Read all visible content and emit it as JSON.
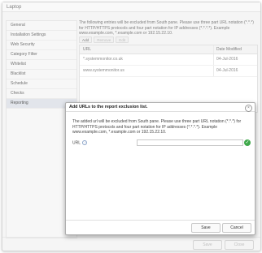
{
  "window": {
    "title": "Laptop"
  },
  "sidebar": {
    "items": [
      {
        "label": "General"
      },
      {
        "label": "Installation Settings"
      },
      {
        "label": "Web Security"
      },
      {
        "label": "Category Filter"
      },
      {
        "label": "Whitelist"
      },
      {
        "label": "Blacklist"
      },
      {
        "label": "Schedule"
      },
      {
        "label": "Checks"
      },
      {
        "label": "Reporting"
      }
    ],
    "active_index": 8
  },
  "main": {
    "description": "The following entries will be excluded from South pane. Please use three part URL notation (*.*.*) for HTTP/HTTPS protocols and four part notation for IP addresses (*.*.*.*). Example www.example.com, *.example.com or 192.15.22.10.",
    "toolbar": {
      "add_label": "Add",
      "remove_label": "Remove",
      "edit_label": "Edit"
    },
    "table": {
      "columns": [
        "URL",
        "Date Modified"
      ],
      "rows": [
        {
          "url": "*.systemmonitor.co.uk",
          "date": "04-Jul-2016"
        },
        {
          "url": "www.systemmonitor.us",
          "date": "04-Jul-2016"
        }
      ]
    }
  },
  "footer": {
    "save_label": "Save",
    "close_label": "Close"
  },
  "dialog": {
    "title": "Add URLs to the report exclusion list.",
    "close_icon": "close-icon",
    "description": "The added url will be excluded from South pane. Please use three part URL notation (*.*.*) for HTTP/HTTPS protocols and four part notation for IP addresses (*.*.*.*). Example www.example.com, *.example.com or 192.15.22.10.",
    "url_label": "URL",
    "info_icon": "info-icon",
    "url_value": "",
    "valid_icon": "check-circle-icon",
    "save_label": "Save",
    "cancel_label": "Cancel"
  },
  "colors": {
    "accent_green": "#3ea84a",
    "active_item_bg": "#d8dde5"
  }
}
